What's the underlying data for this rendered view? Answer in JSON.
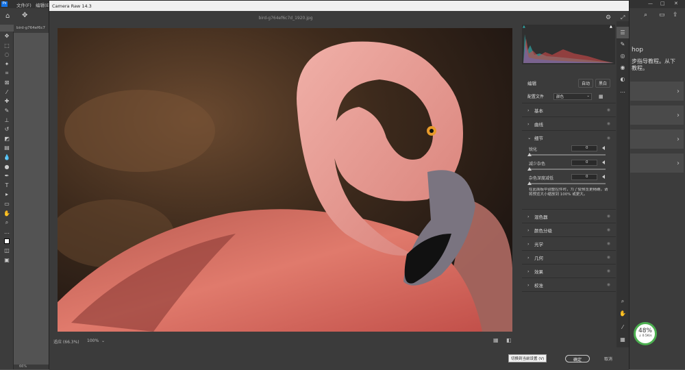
{
  "photoshop": {
    "menu": [
      "文件(F)",
      "编辑(E)"
    ],
    "doc_tab": "bird-g764ef6c7",
    "status_zoom": "66%",
    "right_panel": {
      "title_fragment": "hop",
      "text_line1": "步指导教程。从下",
      "text_line2": "教程。"
    },
    "window_controls": {
      "minimize": "—",
      "maximize": "□",
      "close": "✕"
    }
  },
  "camera_raw": {
    "title": "Camera Raw 14.3",
    "filename": "bird-g764ef6c7d_1920.jpg",
    "zoom_label": "适应 (66.3%)",
    "zoom_select": "100%",
    "edit": {
      "heading": "编辑",
      "auto_button": "自动",
      "bw_button": "黑白",
      "profile_label": "配置文件",
      "profile_value": "颜色"
    },
    "panels_top": [
      "基本",
      "曲线"
    ],
    "detail": {
      "heading": "细节",
      "sliders": [
        {
          "label": "锐化",
          "value": "0"
        },
        {
          "label": "减少杂色",
          "value": "0"
        },
        {
          "label": "杂色深度减低",
          "value": "0"
        }
      ],
      "hint": "在此面板中调整控件时，为了使预览更精确，请将预览大小缩放到 100% 或更大。"
    },
    "panels_bottom": [
      "混色器",
      "颜色分级",
      "光学",
      "几何",
      "效果",
      "校准"
    ],
    "bottom": {
      "tooltip": "切换到当前设置 (V)",
      "ok_button": "确定",
      "cancel_button": "取消"
    }
  },
  "badge": {
    "percent": "48%",
    "speed": "↓ 0.5K/s"
  },
  "colors": {
    "accent": "#1473e6",
    "badge_green": "#4caf50",
    "hist_red": "#d24a4a",
    "hist_teal": "#2fa4a4"
  }
}
